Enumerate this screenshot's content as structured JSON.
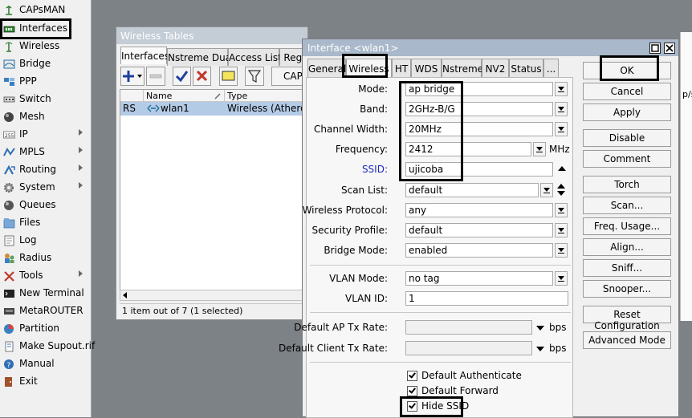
{
  "sidebar": {
    "items": [
      {
        "label": "CAPsMAN",
        "icon": "capsman-icon",
        "has_submenu": false
      },
      {
        "label": "Interfaces",
        "icon": "interfaces-icon",
        "has_submenu": false
      },
      {
        "label": "Wireless",
        "icon": "wireless-icon",
        "has_submenu": false
      },
      {
        "label": "Bridge",
        "icon": "bridge-icon",
        "has_submenu": false
      },
      {
        "label": "PPP",
        "icon": "ppp-icon",
        "has_submenu": false
      },
      {
        "label": "Switch",
        "icon": "switch-icon",
        "has_submenu": false
      },
      {
        "label": "Mesh",
        "icon": "mesh-icon",
        "has_submenu": false
      },
      {
        "label": "IP",
        "icon": "ip-icon",
        "has_submenu": true
      },
      {
        "label": "MPLS",
        "icon": "mpls-icon",
        "has_submenu": true
      },
      {
        "label": "Routing",
        "icon": "routing-icon",
        "has_submenu": true
      },
      {
        "label": "System",
        "icon": "system-gear-icon",
        "has_submenu": true
      },
      {
        "label": "Queues",
        "icon": "queues-icon",
        "has_submenu": false
      },
      {
        "label": "Files",
        "icon": "files-icon",
        "has_submenu": false
      },
      {
        "label": "Log",
        "icon": "log-icon",
        "has_submenu": false
      },
      {
        "label": "Radius",
        "icon": "radius-icon",
        "has_submenu": false
      },
      {
        "label": "Tools",
        "icon": "tools-icon",
        "has_submenu": true
      },
      {
        "label": "New Terminal",
        "icon": "terminal-icon",
        "has_submenu": false
      },
      {
        "label": "MetaROUTER",
        "icon": "metarouter-icon",
        "has_submenu": false
      },
      {
        "label": "Partition",
        "icon": "partition-icon",
        "has_submenu": false
      },
      {
        "label": "Make Supout.rif",
        "icon": "supout-icon",
        "has_submenu": false
      },
      {
        "label": "Manual",
        "icon": "help-icon",
        "has_submenu": false
      },
      {
        "label": "Exit",
        "icon": "exit-icon",
        "has_submenu": false
      }
    ]
  },
  "wireless_tables": {
    "title": "Wireless Tables",
    "tabs": [
      "Interfaces",
      "Nstreme Dual",
      "Access List",
      "Regi"
    ],
    "active_tab": "Interfaces",
    "cap_button": "CAP",
    "columns": [
      "",
      "Name",
      "Type"
    ],
    "rows": [
      {
        "flags": "RS",
        "name": "wlan1",
        "type": "Wireless (Atheros AR"
      }
    ],
    "status": "1 item out of 7 (1 selected)"
  },
  "interface_dialog": {
    "title": "Interface <wlan1>",
    "tabs": [
      "General",
      "Wireless",
      "HT",
      "WDS",
      "Nstreme",
      "NV2",
      "Status",
      "..."
    ],
    "active_tab": "Wireless",
    "fields": {
      "mode": {
        "label": "Mode:",
        "value": "ap bridge"
      },
      "band": {
        "label": "Band:",
        "value": "2GHz-B/G"
      },
      "channel_width": {
        "label": "Channel Width:",
        "value": "20MHz"
      },
      "frequency": {
        "label": "Frequency:",
        "value": "2412",
        "unit": "MHz"
      },
      "ssid": {
        "label": "SSID:",
        "value": "ujicoba"
      },
      "scan_list": {
        "label": "Scan List:",
        "value": "default"
      },
      "wireless_protocol": {
        "label": "Wireless Protocol:",
        "value": "any"
      },
      "security_profile": {
        "label": "Security Profile:",
        "value": "default"
      },
      "bridge_mode": {
        "label": "Bridge Mode:",
        "value": "enabled"
      },
      "vlan_mode": {
        "label": "VLAN Mode:",
        "value": "no tag"
      },
      "vlan_id": {
        "label": "VLAN ID:",
        "value": "1"
      },
      "default_ap_tx_rate": {
        "label": "Default AP Tx Rate:",
        "value": "",
        "unit": "bps"
      },
      "default_client_tx_rate": {
        "label": "Default Client Tx Rate:",
        "value": "",
        "unit": "bps"
      }
    },
    "checkboxes": [
      {
        "label": "Default Authenticate",
        "checked": true
      },
      {
        "label": "Default Forward",
        "checked": true
      },
      {
        "label": "Hide SSID",
        "checked": true
      }
    ],
    "buttons": [
      "OK",
      "Cancel",
      "Apply",
      "Disable",
      "Comment",
      "Torch",
      "Scan...",
      "Freq. Usage...",
      "Align...",
      "Sniff...",
      "Snooper...",
      "Reset Configuration",
      "Advanced Mode"
    ]
  },
  "background_window": {
    "fragment_1": "p/s)"
  },
  "colors": {
    "desktop": "#7d8287",
    "selected_row": "#b4cbe6",
    "ssid_label": "#1f2bb8",
    "highlight_box": "#000000"
  }
}
